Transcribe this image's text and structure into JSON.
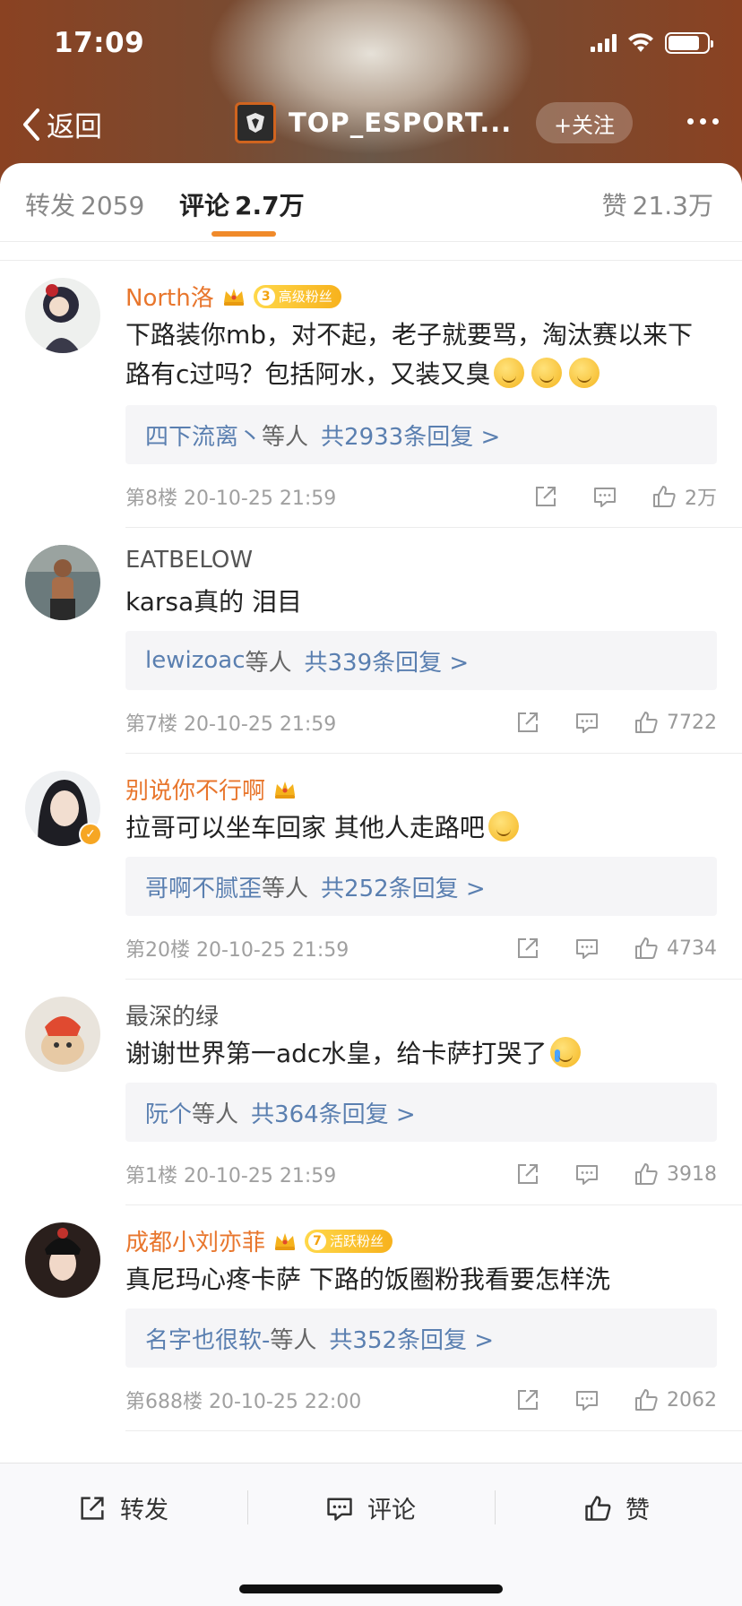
{
  "status_bar": {
    "time": "17:09"
  },
  "nav": {
    "back_label": "返回",
    "title": "TOP_ESPORT...",
    "follow_label": "+关注"
  },
  "tabs": {
    "repost": {
      "label": "转发",
      "count": "2059"
    },
    "comments": {
      "label": "评论",
      "count": "2.7万"
    },
    "likes": {
      "label": "赞",
      "count": "21.3万"
    }
  },
  "colors": {
    "accent": "#f08a2a",
    "name_orange": "#e8762d",
    "link_blue": "#5a7fb0"
  },
  "comments": [
    {
      "name": "North洛",
      "crown": true,
      "fan_badge": {
        "level": "3",
        "label": "高级粉丝"
      },
      "text": "下路装你mb，对不起，老子就要骂，淘汰赛以来下路有c过吗？包括阿水，又装又臭",
      "emoji": [
        "smile-emoji",
        "smile-emoji",
        "smile-emoji"
      ],
      "reply": {
        "who": "四下流离丶",
        "mid": "等人",
        "count": "共2933条回复 >"
      },
      "meta": "第8楼 20-10-25 21:59",
      "likes": "2万"
    },
    {
      "name": "EATBELOW",
      "crown": false,
      "text": "karsa真的 泪目",
      "reply": {
        "who": "lewizoac",
        "mid": "等人",
        "count": "共339条回复 >"
      },
      "meta": "第7楼 20-10-25 21:59",
      "likes": "7722"
    },
    {
      "name": "别说你不行啊",
      "crown": true,
      "verified": true,
      "text": "拉哥可以坐车回家 其他人走路吧",
      "emoji": [
        "upside-down-emoji"
      ],
      "reply": {
        "who": "哥啊不腻歪",
        "mid": "等人",
        "count": "共252条回复 >"
      },
      "meta": "第20楼 20-10-25 21:59",
      "likes": "4734"
    },
    {
      "name": "最深的绿",
      "crown": false,
      "text": "谢谢世界第一adc水皇，给卡萨打哭了",
      "emoji": [
        "crying-emoji"
      ],
      "reply": {
        "who": "阮个",
        "mid": "等人",
        "count": "共364条回复 >"
      },
      "meta": "第1楼 20-10-25 21:59",
      "likes": "3918"
    },
    {
      "name": "成都小刘亦菲",
      "crown": true,
      "fan_badge": {
        "level": "7",
        "label": "活跃粉丝"
      },
      "text": "真尼玛心疼卡萨 下路的饭圈粉我看要怎样洗",
      "reply": {
        "who": "名字也很软-",
        "mid": "等人",
        "count": "共352条回复 >"
      },
      "meta": "第688楼 20-10-25 22:00",
      "likes": "2062"
    }
  ],
  "bottom_bar": {
    "repost": "转发",
    "comment": "评论",
    "like": "赞"
  }
}
